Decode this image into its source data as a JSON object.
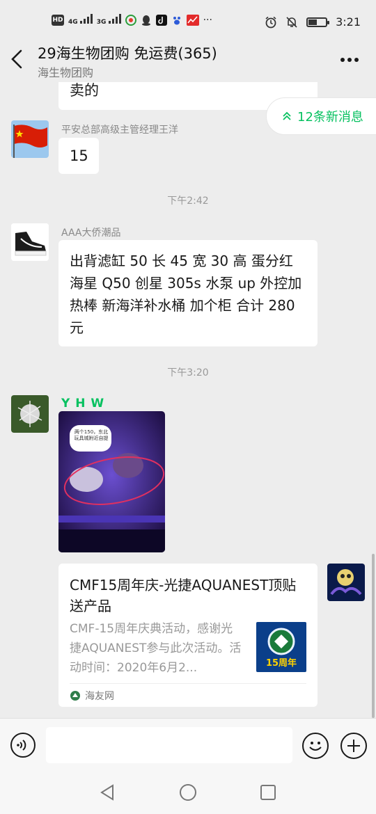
{
  "status_bar": {
    "time": "3:21",
    "hd_badge": "HD",
    "network_1": "4G",
    "network_2": "3G",
    "more_notifications": "···",
    "battery_level": 0.45
  },
  "title_bar": {
    "title": "29海生物团购  免运费(365)",
    "subtitle": "海生物团购"
  },
  "new_messages": {
    "label": "12条新消息"
  },
  "messages": [
    {
      "text": "卖的"
    },
    {
      "sender": "平安总部高级主管经理王洋",
      "text": "15"
    },
    {
      "timestamp": "下午2:42"
    },
    {
      "sender": "AAA大侨潮品",
      "text": "出背滤缸 50 长 45 宽 30 高 蛋分红海星 Q50 创星 305s 水泵 up 外控加热棒 新海洋补水桶 加个柜 合计 280 元"
    },
    {
      "timestamp": "下午3:20"
    },
    {
      "sender": "Y H W",
      "image_caption": "两个150，东北玩具城附近自提"
    }
  ],
  "link_card": {
    "title": "CMF15周年庆-光捷AQUANEST顶贴送产品",
    "description": "CMF-15周年庆典活动，感谢光捷AQUANEST参与此次活动。活动时间：2020年6月2...",
    "thumb_text": "15周年",
    "source": "海友网"
  },
  "colors": {
    "accent_green": "#07c160",
    "sender_yhw": "#07c160"
  },
  "icons": {
    "back": "back-arrow-icon",
    "more": "more-dots-icon",
    "voice": "voice-icon",
    "emoji": "emoji-icon",
    "plus": "plus-icon",
    "nav_back": "nav-back-icon",
    "nav_home": "nav-home-icon",
    "nav_recent": "nav-recent-icon"
  }
}
